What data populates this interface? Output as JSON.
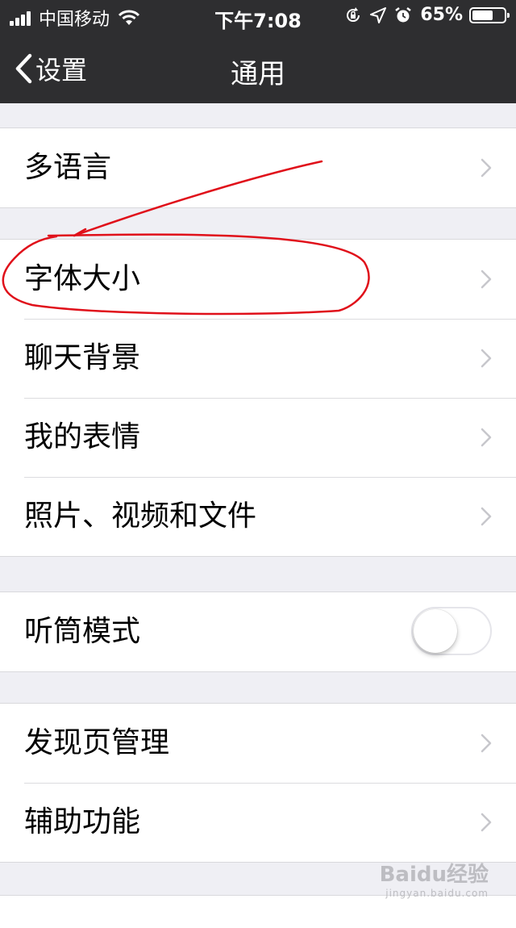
{
  "status_bar": {
    "carrier": "中国移动",
    "time": "下午7:08",
    "battery_percent": "65%",
    "battery_level": 0.65,
    "icons": [
      "signal-icon",
      "wifi-icon",
      "rotation-lock-icon",
      "location-icon",
      "alarm-icon",
      "battery-icon"
    ]
  },
  "nav": {
    "back_label": "设置",
    "title": "通用"
  },
  "groups": [
    {
      "items": [
        {
          "label": "多语言",
          "control": "chevron"
        }
      ]
    },
    {
      "items": [
        {
          "label": "字体大小",
          "control": "chevron"
        },
        {
          "label": "聊天背景",
          "control": "chevron"
        },
        {
          "label": "我的表情",
          "control": "chevron"
        },
        {
          "label": "照片、视频和文件",
          "control": "chevron"
        }
      ]
    },
    {
      "items": [
        {
          "label": "听筒模式",
          "control": "toggle",
          "value": false
        }
      ]
    },
    {
      "items": [
        {
          "label": "发现页管理",
          "control": "chevron"
        },
        {
          "label": "辅助功能",
          "control": "chevron"
        }
      ]
    }
  ],
  "watermark": {
    "text": "Baidu经验",
    "sub": "jingyan.baidu.com"
  },
  "colors": {
    "nav_background": "#2e2e30",
    "page_background": "#efeff4",
    "annotation": "#e0101a",
    "chevron": "#c7c7cc"
  }
}
